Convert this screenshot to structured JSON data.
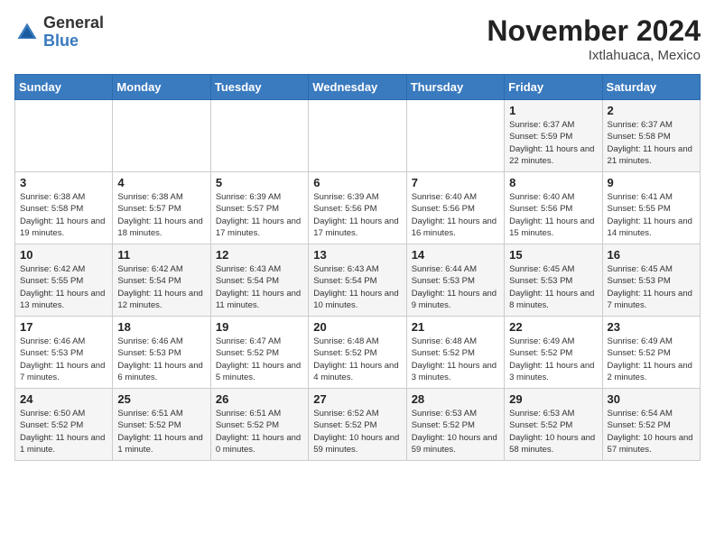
{
  "header": {
    "logo_general": "General",
    "logo_blue": "Blue",
    "month_title": "November 2024",
    "location": "Ixtlahuaca, Mexico"
  },
  "days_of_week": [
    "Sunday",
    "Monday",
    "Tuesday",
    "Wednesday",
    "Thursday",
    "Friday",
    "Saturday"
  ],
  "weeks": [
    [
      {
        "day": "",
        "info": ""
      },
      {
        "day": "",
        "info": ""
      },
      {
        "day": "",
        "info": ""
      },
      {
        "day": "",
        "info": ""
      },
      {
        "day": "",
        "info": ""
      },
      {
        "day": "1",
        "info": "Sunrise: 6:37 AM\nSunset: 5:59 PM\nDaylight: 11 hours and 22 minutes."
      },
      {
        "day": "2",
        "info": "Sunrise: 6:37 AM\nSunset: 5:58 PM\nDaylight: 11 hours and 21 minutes."
      }
    ],
    [
      {
        "day": "3",
        "info": "Sunrise: 6:38 AM\nSunset: 5:58 PM\nDaylight: 11 hours and 19 minutes."
      },
      {
        "day": "4",
        "info": "Sunrise: 6:38 AM\nSunset: 5:57 PM\nDaylight: 11 hours and 18 minutes."
      },
      {
        "day": "5",
        "info": "Sunrise: 6:39 AM\nSunset: 5:57 PM\nDaylight: 11 hours and 17 minutes."
      },
      {
        "day": "6",
        "info": "Sunrise: 6:39 AM\nSunset: 5:56 PM\nDaylight: 11 hours and 17 minutes."
      },
      {
        "day": "7",
        "info": "Sunrise: 6:40 AM\nSunset: 5:56 PM\nDaylight: 11 hours and 16 minutes."
      },
      {
        "day": "8",
        "info": "Sunrise: 6:40 AM\nSunset: 5:56 PM\nDaylight: 11 hours and 15 minutes."
      },
      {
        "day": "9",
        "info": "Sunrise: 6:41 AM\nSunset: 5:55 PM\nDaylight: 11 hours and 14 minutes."
      }
    ],
    [
      {
        "day": "10",
        "info": "Sunrise: 6:42 AM\nSunset: 5:55 PM\nDaylight: 11 hours and 13 minutes."
      },
      {
        "day": "11",
        "info": "Sunrise: 6:42 AM\nSunset: 5:54 PM\nDaylight: 11 hours and 12 minutes."
      },
      {
        "day": "12",
        "info": "Sunrise: 6:43 AM\nSunset: 5:54 PM\nDaylight: 11 hours and 11 minutes."
      },
      {
        "day": "13",
        "info": "Sunrise: 6:43 AM\nSunset: 5:54 PM\nDaylight: 11 hours and 10 minutes."
      },
      {
        "day": "14",
        "info": "Sunrise: 6:44 AM\nSunset: 5:53 PM\nDaylight: 11 hours and 9 minutes."
      },
      {
        "day": "15",
        "info": "Sunrise: 6:45 AM\nSunset: 5:53 PM\nDaylight: 11 hours and 8 minutes."
      },
      {
        "day": "16",
        "info": "Sunrise: 6:45 AM\nSunset: 5:53 PM\nDaylight: 11 hours and 7 minutes."
      }
    ],
    [
      {
        "day": "17",
        "info": "Sunrise: 6:46 AM\nSunset: 5:53 PM\nDaylight: 11 hours and 7 minutes."
      },
      {
        "day": "18",
        "info": "Sunrise: 6:46 AM\nSunset: 5:53 PM\nDaylight: 11 hours and 6 minutes."
      },
      {
        "day": "19",
        "info": "Sunrise: 6:47 AM\nSunset: 5:52 PM\nDaylight: 11 hours and 5 minutes."
      },
      {
        "day": "20",
        "info": "Sunrise: 6:48 AM\nSunset: 5:52 PM\nDaylight: 11 hours and 4 minutes."
      },
      {
        "day": "21",
        "info": "Sunrise: 6:48 AM\nSunset: 5:52 PM\nDaylight: 11 hours and 3 minutes."
      },
      {
        "day": "22",
        "info": "Sunrise: 6:49 AM\nSunset: 5:52 PM\nDaylight: 11 hours and 3 minutes."
      },
      {
        "day": "23",
        "info": "Sunrise: 6:49 AM\nSunset: 5:52 PM\nDaylight: 11 hours and 2 minutes."
      }
    ],
    [
      {
        "day": "24",
        "info": "Sunrise: 6:50 AM\nSunset: 5:52 PM\nDaylight: 11 hours and 1 minute."
      },
      {
        "day": "25",
        "info": "Sunrise: 6:51 AM\nSunset: 5:52 PM\nDaylight: 11 hours and 1 minute."
      },
      {
        "day": "26",
        "info": "Sunrise: 6:51 AM\nSunset: 5:52 PM\nDaylight: 11 hours and 0 minutes."
      },
      {
        "day": "27",
        "info": "Sunrise: 6:52 AM\nSunset: 5:52 PM\nDaylight: 10 hours and 59 minutes."
      },
      {
        "day": "28",
        "info": "Sunrise: 6:53 AM\nSunset: 5:52 PM\nDaylight: 10 hours and 59 minutes."
      },
      {
        "day": "29",
        "info": "Sunrise: 6:53 AM\nSunset: 5:52 PM\nDaylight: 10 hours and 58 minutes."
      },
      {
        "day": "30",
        "info": "Sunrise: 6:54 AM\nSunset: 5:52 PM\nDaylight: 10 hours and 57 minutes."
      }
    ]
  ]
}
